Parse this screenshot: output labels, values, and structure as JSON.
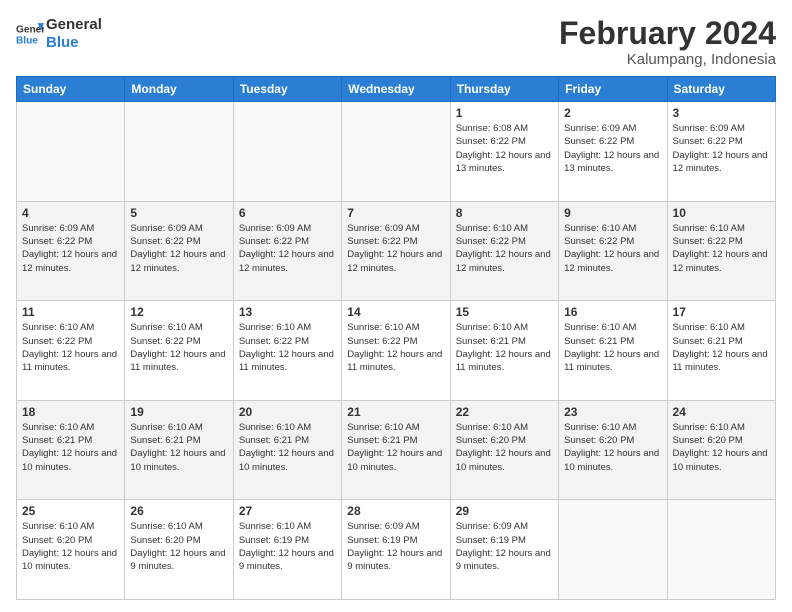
{
  "logo": {
    "line1": "General",
    "line2": "Blue"
  },
  "title": "February 2024",
  "subtitle": "Kalumpang, Indonesia",
  "days_of_week": [
    "Sunday",
    "Monday",
    "Tuesday",
    "Wednesday",
    "Thursday",
    "Friday",
    "Saturday"
  ],
  "weeks": [
    [
      {
        "num": "",
        "info": ""
      },
      {
        "num": "",
        "info": ""
      },
      {
        "num": "",
        "info": ""
      },
      {
        "num": "",
        "info": ""
      },
      {
        "num": "1",
        "info": "Sunrise: 6:08 AM\nSunset: 6:22 PM\nDaylight: 12 hours and 13 minutes."
      },
      {
        "num": "2",
        "info": "Sunrise: 6:09 AM\nSunset: 6:22 PM\nDaylight: 12 hours and 13 minutes."
      },
      {
        "num": "3",
        "info": "Sunrise: 6:09 AM\nSunset: 6:22 PM\nDaylight: 12 hours and 12 minutes."
      }
    ],
    [
      {
        "num": "4",
        "info": "Sunrise: 6:09 AM\nSunset: 6:22 PM\nDaylight: 12 hours and 12 minutes."
      },
      {
        "num": "5",
        "info": "Sunrise: 6:09 AM\nSunset: 6:22 PM\nDaylight: 12 hours and 12 minutes."
      },
      {
        "num": "6",
        "info": "Sunrise: 6:09 AM\nSunset: 6:22 PM\nDaylight: 12 hours and 12 minutes."
      },
      {
        "num": "7",
        "info": "Sunrise: 6:09 AM\nSunset: 6:22 PM\nDaylight: 12 hours and 12 minutes."
      },
      {
        "num": "8",
        "info": "Sunrise: 6:10 AM\nSunset: 6:22 PM\nDaylight: 12 hours and 12 minutes."
      },
      {
        "num": "9",
        "info": "Sunrise: 6:10 AM\nSunset: 6:22 PM\nDaylight: 12 hours and 12 minutes."
      },
      {
        "num": "10",
        "info": "Sunrise: 6:10 AM\nSunset: 6:22 PM\nDaylight: 12 hours and 12 minutes."
      }
    ],
    [
      {
        "num": "11",
        "info": "Sunrise: 6:10 AM\nSunset: 6:22 PM\nDaylight: 12 hours and 11 minutes."
      },
      {
        "num": "12",
        "info": "Sunrise: 6:10 AM\nSunset: 6:22 PM\nDaylight: 12 hours and 11 minutes."
      },
      {
        "num": "13",
        "info": "Sunrise: 6:10 AM\nSunset: 6:22 PM\nDaylight: 12 hours and 11 minutes."
      },
      {
        "num": "14",
        "info": "Sunrise: 6:10 AM\nSunset: 6:22 PM\nDaylight: 12 hours and 11 minutes."
      },
      {
        "num": "15",
        "info": "Sunrise: 6:10 AM\nSunset: 6:21 PM\nDaylight: 12 hours and 11 minutes."
      },
      {
        "num": "16",
        "info": "Sunrise: 6:10 AM\nSunset: 6:21 PM\nDaylight: 12 hours and 11 minutes."
      },
      {
        "num": "17",
        "info": "Sunrise: 6:10 AM\nSunset: 6:21 PM\nDaylight: 12 hours and 11 minutes."
      }
    ],
    [
      {
        "num": "18",
        "info": "Sunrise: 6:10 AM\nSunset: 6:21 PM\nDaylight: 12 hours and 10 minutes."
      },
      {
        "num": "19",
        "info": "Sunrise: 6:10 AM\nSunset: 6:21 PM\nDaylight: 12 hours and 10 minutes."
      },
      {
        "num": "20",
        "info": "Sunrise: 6:10 AM\nSunset: 6:21 PM\nDaylight: 12 hours and 10 minutes."
      },
      {
        "num": "21",
        "info": "Sunrise: 6:10 AM\nSunset: 6:21 PM\nDaylight: 12 hours and 10 minutes."
      },
      {
        "num": "22",
        "info": "Sunrise: 6:10 AM\nSunset: 6:20 PM\nDaylight: 12 hours and 10 minutes."
      },
      {
        "num": "23",
        "info": "Sunrise: 6:10 AM\nSunset: 6:20 PM\nDaylight: 12 hours and 10 minutes."
      },
      {
        "num": "24",
        "info": "Sunrise: 6:10 AM\nSunset: 6:20 PM\nDaylight: 12 hours and 10 minutes."
      }
    ],
    [
      {
        "num": "25",
        "info": "Sunrise: 6:10 AM\nSunset: 6:20 PM\nDaylight: 12 hours and 10 minutes."
      },
      {
        "num": "26",
        "info": "Sunrise: 6:10 AM\nSunset: 6:20 PM\nDaylight: 12 hours and 9 minutes."
      },
      {
        "num": "27",
        "info": "Sunrise: 6:10 AM\nSunset: 6:19 PM\nDaylight: 12 hours and 9 minutes."
      },
      {
        "num": "28",
        "info": "Sunrise: 6:09 AM\nSunset: 6:19 PM\nDaylight: 12 hours and 9 minutes."
      },
      {
        "num": "29",
        "info": "Sunrise: 6:09 AM\nSunset: 6:19 PM\nDaylight: 12 hours and 9 minutes."
      },
      {
        "num": "",
        "info": ""
      },
      {
        "num": "",
        "info": ""
      }
    ]
  ]
}
